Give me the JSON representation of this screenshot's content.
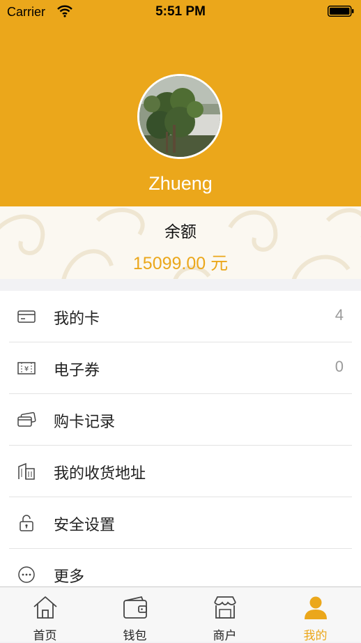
{
  "status_bar": {
    "carrier": "Carrier",
    "time": "5:51 PM"
  },
  "profile": {
    "username": "Zhueng"
  },
  "balance": {
    "label": "余额",
    "value": "15099.00 元"
  },
  "menu": {
    "items": [
      {
        "label": "我的卡",
        "count": "4",
        "icon": "card-icon"
      },
      {
        "label": "电子券",
        "count": "0",
        "icon": "coupon-icon"
      },
      {
        "label": "购卡记录",
        "count": "",
        "icon": "cards-record-icon"
      },
      {
        "label": "我的收货地址",
        "count": "",
        "icon": "building-icon"
      },
      {
        "label": "安全设置",
        "count": "",
        "icon": "lock-icon"
      },
      {
        "label": "更多",
        "count": "",
        "icon": "more-icon"
      }
    ]
  },
  "tabbar": {
    "tabs": [
      {
        "label": "首页",
        "icon": "home-icon"
      },
      {
        "label": "钱包",
        "icon": "wallet-icon"
      },
      {
        "label": "商户",
        "icon": "store-icon"
      },
      {
        "label": "我的",
        "icon": "user-icon"
      }
    ],
    "active_index": 3
  },
  "colors": {
    "accent": "#eba71b",
    "muted": "#9a9a9a"
  }
}
